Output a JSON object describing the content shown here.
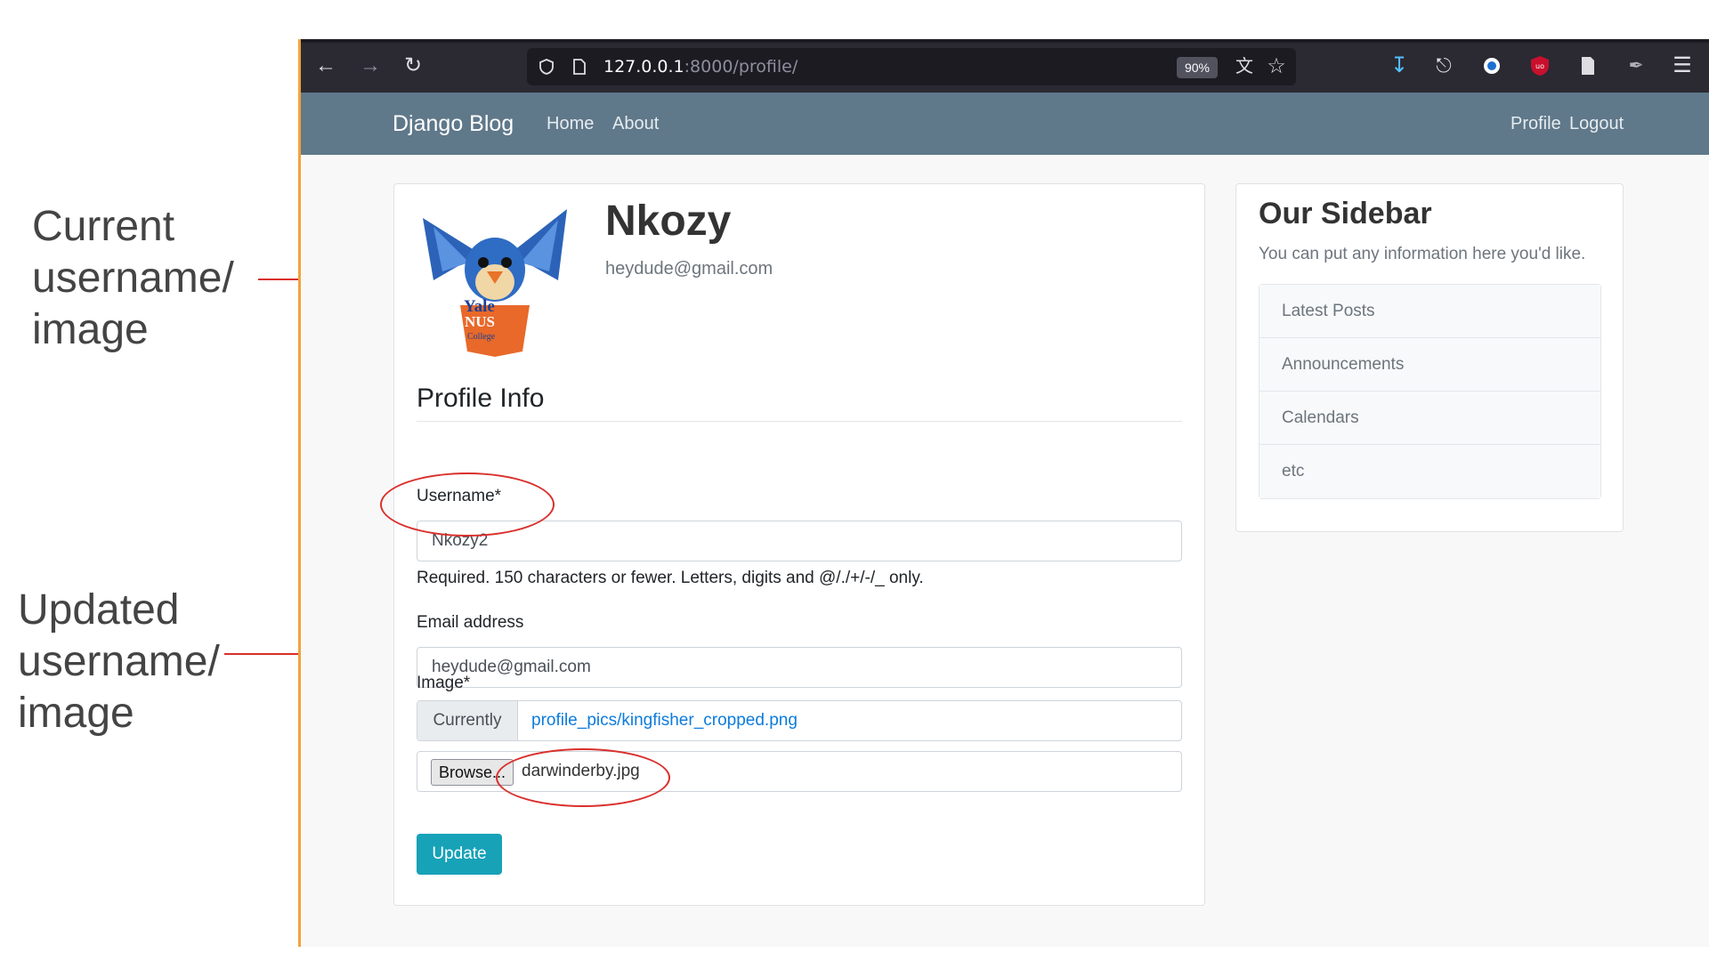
{
  "annotations": {
    "current": [
      "Current",
      "username/",
      "image"
    ],
    "updated": [
      "Updated",
      "username/",
      "image"
    ]
  },
  "browser": {
    "url_host": "127.0.0.1",
    "url_rest": ":8000/profile/",
    "zoom": "90%"
  },
  "navbar": {
    "brand": "Django Blog",
    "links": [
      "Home",
      "About"
    ],
    "right_links": [
      "Profile",
      "Logout"
    ]
  },
  "profile": {
    "username": "Nkozy",
    "email": "heydude@gmail.com",
    "avatar_text": [
      "Yale",
      "NUS",
      "College"
    ]
  },
  "form": {
    "legend": "Profile Info",
    "username_label": "Username*",
    "username_value": "Nkozy2",
    "username_help": "Required. 150 characters or fewer. Letters, digits and @/./+/-/_ only.",
    "email_label": "Email address",
    "email_value": "heydude@gmail.com",
    "image_label": "Image*",
    "currently_label": "Currently",
    "current_image": "profile_pics/kingfisher_cropped.png",
    "browse_label": "Browse...",
    "selected_file": "darwinderby.jpg",
    "submit_label": "Update"
  },
  "sidebar": {
    "title": "Our Sidebar",
    "subtitle": "You can put any information here you'd like.",
    "items": [
      "Latest Posts",
      "Announcements",
      "Calendars",
      "etc"
    ]
  },
  "colors": {
    "navbar": "#5f788a",
    "annotation_red": "#d9302c",
    "button": "#17a2b8",
    "link": "#0d7bdc"
  }
}
